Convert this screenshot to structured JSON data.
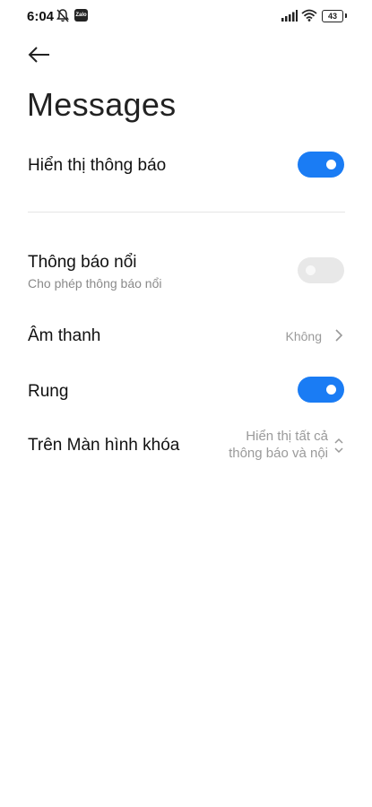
{
  "status_bar": {
    "time": "6:04",
    "zalo_label": "Zalo",
    "battery": "43"
  },
  "header": {
    "title": "Messages"
  },
  "settings": {
    "show_notifications": {
      "label": "Hiển thị thông báo",
      "enabled": true
    },
    "floating": {
      "label": "Thông báo nổi",
      "subtitle": "Cho phép thông báo nổi",
      "enabled": false
    },
    "sound": {
      "label": "Âm thanh",
      "value": "Không"
    },
    "vibrate": {
      "label": "Rung",
      "enabled": true
    },
    "lock_screen": {
      "label": "Trên Màn hình khóa",
      "value_line1": "Hiển thị tất cả",
      "value_line2": "thông báo và nội"
    }
  },
  "colors": {
    "accent": "#1a7cf4",
    "toggle_off": "#e8e8e8"
  }
}
